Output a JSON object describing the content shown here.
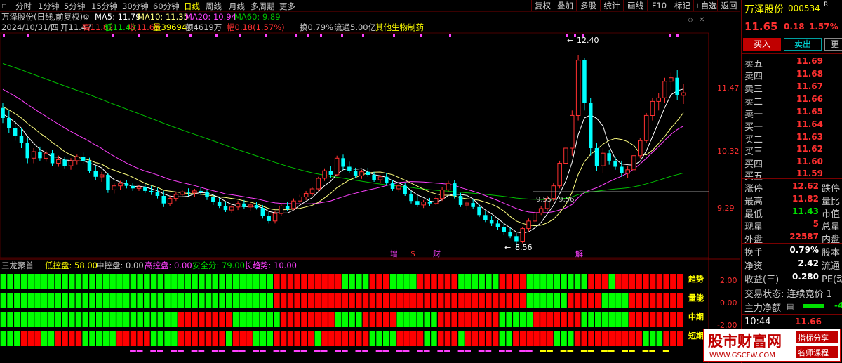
{
  "toolbar": {
    "periods": [
      "分时",
      "1分钟",
      "5分钟",
      "15分钟",
      "30分钟",
      "60分钟",
      "日线",
      "周线",
      "月线",
      "多周期",
      "更多"
    ],
    "active_period": "日线",
    "right_buttons": [
      "复权",
      "叠加",
      "多股",
      "统计",
      "画线",
      "F10",
      "标记",
      "+自选",
      "返回"
    ]
  },
  "header": {
    "title": "万泽股份(日线,前复权)",
    "ma5": "MA5: 11.79",
    "ma10": "MA10: 11.35",
    "ma20": "MA20: 10.94",
    "ma60": "MA60: 9.89",
    "date": "2024/10/31/四",
    "open": "开11.47",
    "high": "高11.82",
    "low": "低11.43",
    "close": "收11.65",
    "volume": "量39694",
    "amount": "额4619万",
    "change": "幅0.18(1.57%)",
    "turnover": "换0.79%",
    "float_cap": "流通5.00亿",
    "sector": "其他生物制药"
  },
  "price_axis": {
    "labels": [
      "11.47",
      "10.32",
      "9.29"
    ]
  },
  "annotations": {
    "high_mark": "12.40",
    "low_mark": "8.56",
    "line_mark": "9.55 - 9.56",
    "event_markers": [
      "增",
      "$",
      "财",
      "解"
    ]
  },
  "indicator": {
    "name": "三龙聚首",
    "low_ctrl": "低控盘: 58.00",
    "mid_ctrl": "中控盘: 0.00",
    "high_ctrl": "高控盘: 0.00",
    "safe": "安全分: 79.00",
    "long_trend": "长趋势: 10.00",
    "row_labels": [
      "趋势",
      "量能",
      "中期",
      "短期"
    ],
    "axis_labels": [
      "2.00",
      "0.00",
      "-2.00"
    ]
  },
  "colors": {
    "up": "#ff3030",
    "down": "#00ffff",
    "green_cell": "#00ff00",
    "red_cell": "#ff0000",
    "ma5": "#ffffff",
    "ma10": "#ffff80",
    "ma20": "#ff40ff",
    "ma60": "#00c000"
  },
  "quote": {
    "name": "万泽股份",
    "code": "000534",
    "code_tag": "R",
    "price": "11.65",
    "change": "0.18",
    "pct": "1.57%",
    "buy_btn": "买入",
    "sell_btn": "卖出",
    "more_btn": "更",
    "asks": [
      {
        "label": "卖五",
        "price": "11.69"
      },
      {
        "label": "卖四",
        "price": "11.68"
      },
      {
        "label": "卖三",
        "price": "11.67"
      },
      {
        "label": "卖二",
        "price": "11.66"
      },
      {
        "label": "卖一",
        "price": "11.65"
      }
    ],
    "bids": [
      {
        "label": "买一",
        "price": "11.64"
      },
      {
        "label": "买二",
        "price": "11.63"
      },
      {
        "label": "买三",
        "price": "11.62"
      },
      {
        "label": "买四",
        "price": "11.60"
      },
      {
        "label": "买五",
        "price": "11.59"
      }
    ],
    "stats": [
      {
        "label": "涨停",
        "value": "12.62",
        "extra": "跌停",
        "color": "red"
      },
      {
        "label": "最高",
        "value": "11.82",
        "extra": "量比",
        "color": "red"
      },
      {
        "label": "最低",
        "value": "11.43",
        "extra": "市值",
        "color": "green"
      },
      {
        "label": "现量",
        "value": "5",
        "extra": "总量",
        "color": "red"
      },
      {
        "label": "外盘",
        "value": "22587",
        "extra": "内盘",
        "color": "red"
      }
    ],
    "fundamentals": [
      {
        "label": "换手",
        "value": "0.79%",
        "extra": "股本"
      },
      {
        "label": "净资",
        "value": "2.42",
        "extra": "流通"
      },
      {
        "label": "收益(三)",
        "value": "0.280",
        "extra": "PE(动)"
      }
    ],
    "trade_status": "交易状态: 连续竞价 1",
    "main_flow_label": "主力净额",
    "main_flow_value": "-4",
    "last_tick_time": "10:44",
    "last_tick_price": "11.66"
  },
  "watermark": {
    "title": "股市财富网",
    "url": "WWW.GSCFW.COM",
    "tag1": "指标分享",
    "tag2": "名师课程"
  },
  "chart_data": {
    "type": "candlestick",
    "symbol": "万泽股份",
    "ohlc": [
      [
        11.35,
        11.45,
        11.05,
        11.15
      ],
      [
        11.15,
        11.3,
        10.85,
        10.95
      ],
      [
        10.95,
        11.1,
        10.7,
        10.8
      ],
      [
        10.8,
        10.95,
        10.55,
        10.65
      ],
      [
        10.65,
        10.75,
        10.25,
        10.35
      ],
      [
        10.35,
        10.55,
        10.25,
        10.48
      ],
      [
        10.48,
        10.58,
        10.3,
        10.35
      ],
      [
        10.35,
        10.5,
        10.28,
        10.45
      ],
      [
        10.45,
        10.52,
        10.2,
        10.25
      ],
      [
        10.25,
        10.4,
        10.18,
        10.32
      ],
      [
        10.32,
        10.38,
        10.15,
        10.2
      ],
      [
        10.2,
        10.35,
        10.12,
        10.3
      ],
      [
        10.3,
        10.42,
        10.22,
        10.38
      ],
      [
        10.38,
        10.46,
        10.25,
        10.3
      ],
      [
        10.3,
        10.36,
        10.05,
        10.1
      ],
      [
        10.1,
        10.2,
        9.92,
        9.98
      ],
      [
        9.98,
        10.08,
        9.88,
        10.02
      ],
      [
        10.02,
        10.06,
        9.66,
        9.72
      ],
      [
        9.72,
        9.85,
        9.65,
        9.8
      ],
      [
        9.8,
        9.9,
        9.72,
        9.85
      ],
      [
        9.85,
        9.92,
        9.75,
        9.8
      ],
      [
        9.8,
        9.86,
        9.7,
        9.75
      ],
      [
        9.75,
        9.82,
        9.7,
        9.78
      ],
      [
        9.78,
        9.84,
        9.66,
        9.7
      ],
      [
        9.7,
        9.8,
        9.62,
        9.68
      ],
      [
        9.68,
        9.76,
        9.55,
        9.6
      ],
      [
        9.6,
        9.7,
        9.38,
        9.45
      ],
      [
        9.45,
        9.6,
        9.4,
        9.55
      ],
      [
        9.55,
        9.68,
        9.5,
        9.63
      ],
      [
        9.63,
        9.72,
        9.58,
        9.68
      ],
      [
        9.68,
        9.75,
        9.6,
        9.66
      ],
      [
        9.66,
        9.74,
        9.58,
        9.7
      ],
      [
        9.7,
        9.78,
        9.62,
        9.67
      ],
      [
        9.67,
        9.72,
        9.52,
        9.58
      ],
      [
        9.58,
        9.64,
        9.42,
        9.48
      ],
      [
        9.48,
        9.56,
        9.36,
        9.4
      ],
      [
        9.4,
        9.48,
        9.28,
        9.32
      ],
      [
        9.32,
        9.44,
        9.26,
        9.38
      ],
      [
        9.38,
        9.5,
        9.32,
        9.45
      ],
      [
        9.45,
        9.52,
        9.34,
        9.38
      ],
      [
        9.38,
        9.46,
        9.3,
        9.42
      ],
      [
        9.42,
        9.48,
        9.33,
        9.36
      ],
      [
        9.36,
        9.42,
        9.15,
        9.2
      ],
      [
        9.2,
        9.28,
        9.05,
        9.1
      ],
      [
        9.1,
        9.3,
        9.05,
        9.25
      ],
      [
        9.25,
        9.45,
        9.2,
        9.4
      ],
      [
        9.4,
        9.48,
        9.3,
        9.35
      ],
      [
        9.35,
        9.55,
        9.32,
        9.5
      ],
      [
        9.5,
        9.62,
        9.45,
        9.58
      ],
      [
        9.58,
        9.7,
        9.52,
        9.65
      ],
      [
        9.65,
        9.78,
        9.6,
        9.74
      ],
      [
        9.74,
        9.98,
        9.7,
        9.95
      ],
      [
        9.95,
        10.15,
        9.9,
        10.1
      ],
      [
        10.1,
        10.2,
        9.95,
        10.02
      ],
      [
        10.02,
        10.4,
        10.0,
        10.35
      ],
      [
        10.35,
        10.42,
        10.12,
        10.18
      ],
      [
        10.18,
        10.28,
        10.05,
        10.1
      ],
      [
        10.1,
        10.16,
        9.96,
        10.0
      ],
      [
        10.0,
        10.12,
        9.94,
        10.08
      ],
      [
        10.08,
        10.16,
        9.98,
        10.02
      ],
      [
        10.02,
        10.08,
        9.88,
        9.92
      ],
      [
        9.92,
        10.02,
        9.86,
        9.98
      ],
      [
        9.98,
        10.06,
        9.82,
        9.85
      ],
      [
        9.85,
        9.92,
        9.7,
        9.74
      ],
      [
        9.74,
        9.86,
        9.68,
        9.8
      ],
      [
        9.8,
        9.86,
        9.6,
        9.64
      ],
      [
        9.64,
        9.7,
        9.45,
        9.5
      ],
      [
        9.5,
        9.6,
        9.38,
        9.42
      ],
      [
        9.42,
        9.52,
        9.36,
        9.48
      ],
      [
        9.48,
        9.56,
        9.4,
        9.45
      ],
      [
        9.45,
        9.6,
        9.42,
        9.55
      ],
      [
        9.55,
        9.78,
        9.5,
        9.72
      ],
      [
        9.72,
        9.9,
        9.68,
        9.85
      ],
      [
        9.85,
        9.92,
        9.55,
        9.6
      ],
      [
        9.6,
        9.66,
        9.38,
        9.42
      ],
      [
        9.42,
        9.5,
        9.32,
        9.46
      ],
      [
        9.46,
        9.54,
        9.34,
        9.38
      ],
      [
        9.38,
        9.44,
        9.18,
        9.22
      ],
      [
        9.22,
        9.3,
        9.08,
        9.12
      ],
      [
        9.12,
        9.2,
        9.0,
        9.05
      ],
      [
        9.05,
        9.12,
        8.92,
        8.98
      ],
      [
        8.98,
        9.06,
        8.82,
        8.88
      ],
      [
        8.88,
        8.96,
        8.76,
        8.8
      ],
      [
        8.8,
        8.86,
        8.56,
        8.7
      ],
      [
        8.7,
        8.98,
        8.66,
        8.95
      ],
      [
        8.95,
        9.15,
        8.9,
        9.1
      ],
      [
        9.1,
        9.3,
        9.05,
        9.26
      ],
      [
        9.26,
        9.4,
        9.22,
        9.35
      ],
      [
        9.35,
        9.6,
        9.3,
        9.55
      ],
      [
        9.55,
        9.85,
        9.5,
        9.8
      ],
      [
        9.8,
        10.3,
        9.75,
        10.25
      ],
      [
        10.25,
        10.6,
        10.1,
        10.55
      ],
      [
        10.55,
        11.3,
        10.4,
        11.2
      ],
      [
        11.2,
        12.4,
        11.1,
        12.3
      ],
      [
        12.3,
        12.35,
        11.3,
        11.45
      ],
      [
        11.45,
        11.55,
        10.4,
        10.55
      ],
      [
        10.55,
        10.65,
        10.1,
        10.2
      ],
      [
        10.2,
        10.55,
        10.05,
        10.45
      ],
      [
        10.45,
        10.52,
        10.22,
        10.3
      ],
      [
        10.3,
        10.38,
        10.12,
        10.18
      ],
      [
        10.18,
        10.3,
        9.98,
        10.05
      ],
      [
        10.05,
        10.2,
        9.95,
        10.12
      ],
      [
        10.12,
        10.45,
        10.08,
        10.4
      ],
      [
        10.4,
        10.75,
        10.35,
        10.7
      ],
      [
        10.7,
        11.25,
        10.65,
        11.2
      ],
      [
        11.2,
        11.55,
        11.1,
        11.48
      ],
      [
        11.48,
        11.65,
        11.3,
        11.55
      ],
      [
        11.55,
        11.95,
        11.45,
        11.88
      ],
      [
        11.88,
        12.05,
        11.7,
        11.95
      ],
      [
        11.95,
        12.1,
        11.5,
        11.6
      ],
      [
        11.6,
        11.82,
        11.43,
        11.65
      ]
    ],
    "ma_labels": [
      "MA5",
      "MA10",
      "MA20",
      "MA60"
    ],
    "ylim": [
      8.4,
      12.7
    ]
  }
}
